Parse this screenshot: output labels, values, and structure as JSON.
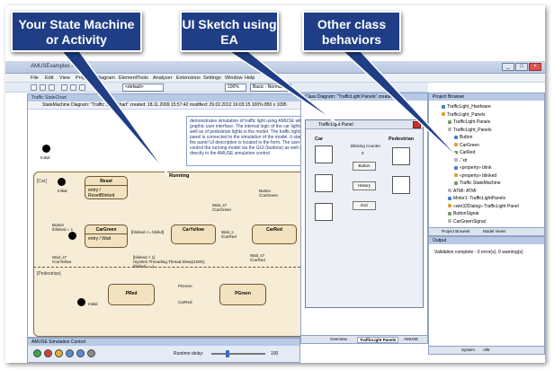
{
  "callouts": {
    "left": "Your State Machine or Activity",
    "middle": "UI Sketch using EA",
    "right": "Other class behaviors"
  },
  "window": {
    "title": "AMUSExamples - EA"
  },
  "menu": [
    "File",
    "Edit",
    "View",
    "Project",
    "Diagram",
    "Element",
    "Tools",
    "Analyzer",
    "Extensions",
    "Settings",
    "Window",
    "Help"
  ],
  "toolbar": {
    "combo": "<default>",
    "zoom": "100%",
    "mode": "Basic - Normal"
  },
  "state_diagram": {
    "tab": "Traffic StateChart",
    "header": "StateMachine Diagram: \"Traffic StateChart\"   created: 18.11.2009 15:57:42  modified: 29.02.2012 16:03:15   100%   850 x 1095",
    "note": "demonstrates simulation of traffic light using AMUSE with a graphic user interface. The internal logic of the car lights as well as of pedestrian lights is the model. The traffic lights panel is connected to the simulation of the model. It start the panel UI description is located in the form. The user can control the running model via the GUI (buttons) as well as directly in the AMUSE simulation control.",
    "composite_label": "Running",
    "car_region": "[Car]",
    "pedestrian_region": "[Pedestrian]",
    "states": {
      "reset": {
        "name": "Reset",
        "body": "entry / ResetBlinked"
      },
      "cargreen": {
        "name": "CarGreen",
        "body": "entry / Wait"
      },
      "caryellow": {
        "name": "CarYellow"
      },
      "carred": {
        "name": "CarRed"
      },
      "pred": {
        "name": "PRed"
      },
      "pgreen": {
        "name": "PGreen"
      }
    },
    "labels": {
      "initial_top": "Initial",
      "initial_car": "Initial",
      "initial_ped": "Initial",
      "button": "Button\n/blinked = 1",
      "button_hold": "Button\n/blinked += 1",
      "blinked_check": "[blinked <= blinkd]",
      "wait_top": "Wait_s7\n/CarGreen",
      "button_right": "Button\n/CarGreen",
      "wait_mid": "Wait_s\n/CarRed",
      "wait_low": "Wait_s7\n/CarRed",
      "wait_left": "Wait_s7\n/CarYellow",
      "blinked_guard": "[blinked > 1]\n/System.Threading.Thread.Sleep(1000);\nblinked -= 1",
      "pgreen_transition": "PGreen",
      "carred_transition": "CarRed"
    }
  },
  "class_diagram": {
    "title": "Class Diagram: \"TrafficLight Panels\"   created: 29",
    "panel_title": "TrafficLight Panel",
    "car_label": "Car",
    "pedestrian_label": "Pedestrian",
    "blinking_counter": "Blinking Counter",
    "counter_value": "0",
    "buttons": [
      "Button",
      "History",
      "Exit"
    ],
    "tabs": [
      "Overview",
      "TrafficLight Panels",
      "AMUSE"
    ]
  },
  "project_browser": {
    "title": "Project Browser",
    "items": [
      {
        "label": "TrafficLight_Hardware",
        "indent": 2
      },
      {
        "label": "TrafficLight_Panels",
        "indent": 2
      },
      {
        "label": "TrafficLight Panels",
        "indent": 3
      },
      {
        "label": "TrafficLight_Panels",
        "indent": 3
      },
      {
        "label": "Button",
        "indent": 4
      },
      {
        "label": "CarGreen",
        "indent": 4
      },
      {
        "label": "CarRed",
        "indent": 4
      },
      {
        "label": "Exit",
        "indent": 4
      },
      {
        "label": "«property» blink",
        "indent": 4
      },
      {
        "label": "«property» blinked",
        "indent": 4
      },
      {
        "label": "Traffic StateMachine",
        "indent": 4
      },
      {
        "label": "ATMI: ATMI",
        "indent": 3
      },
      {
        "label": "Motor1: TrafficLightPanels",
        "indent": 3
      },
      {
        "label": "«win32Dialog» TrafficLight Panel",
        "indent": 3
      },
      {
        "label": "ButtonSignal",
        "indent": 3
      },
      {
        "label": "CarGreenSignal",
        "indent": 3
      }
    ],
    "tabs": [
      "Project Browser",
      "Model Views"
    ]
  },
  "output": {
    "title": "Output",
    "message": "Validation complete - 0 error(s), 0 warning(s)",
    "tabs": [
      "System",
      "All6"
    ]
  },
  "simulation": {
    "title": "AMUSE Simulation Control",
    "runtime_label": "Runtime delay:",
    "runtime_value": "100"
  },
  "colors": {
    "callout_bg": "#1f3e86",
    "state_fill": "#f3e2bf",
    "composite_fill": "#f7ecd6"
  }
}
